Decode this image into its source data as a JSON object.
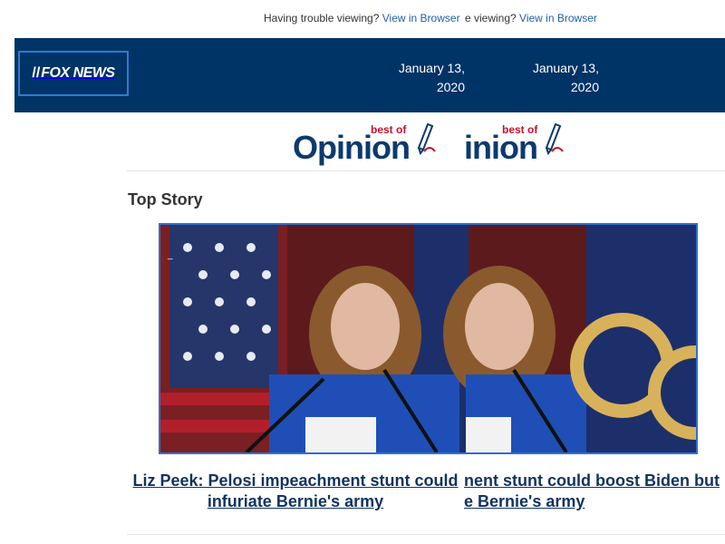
{
  "topbar": {
    "trouble_text": "Having trouble viewing?",
    "view_in_browser": "View in Browser",
    "dup_text": "e viewing?",
    "dup_link": "View in Browser"
  },
  "header": {
    "logo_text": "FOX NEWS",
    "date_a": "January 13, 2020",
    "date_b": "January 13, 2020",
    "colors": {
      "bar": "#003366",
      "logo_border": "#2f7bd3"
    }
  },
  "opinion_logo": {
    "best_of": "best of",
    "word_a": "Opinion",
    "word_b": "inion"
  },
  "section": {
    "title": "Top Story"
  },
  "story": {
    "headline_a": "Liz Peek: Pelosi impeachment stunt could infuriate Bernie's army",
    "headline_b": "nent stunt could boost Biden but e Bernie's army",
    "image_alt": "Nancy Pelosi in blue in front of flags",
    "image_mark": "_"
  }
}
